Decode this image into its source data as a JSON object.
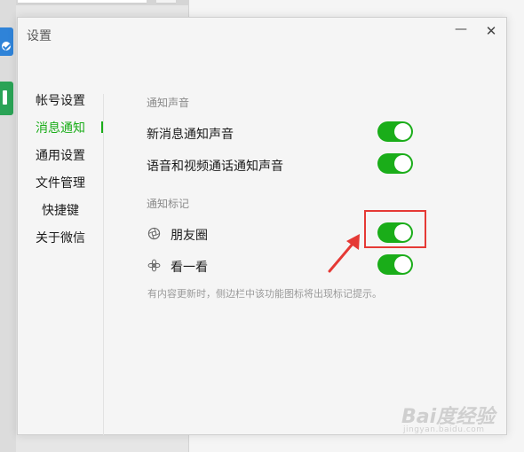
{
  "dialog": {
    "title": "设置",
    "minimize_glyph": "—",
    "close_glyph": "✕"
  },
  "nav": {
    "items": [
      {
        "label": "帐号设置",
        "active": false
      },
      {
        "label": "消息通知",
        "active": true
      },
      {
        "label": "通用设置",
        "active": false
      },
      {
        "label": "文件管理",
        "active": false
      },
      {
        "label": "快捷键",
        "active": false
      },
      {
        "label": "关于微信",
        "active": false
      }
    ]
  },
  "sections": {
    "sound_title": "通知声音",
    "badge_title": "通知标记"
  },
  "settings": {
    "new_message_sound": {
      "label": "新消息通知声音",
      "enabled": true
    },
    "call_sound": {
      "label": "语音和视频通话通知声音",
      "enabled": true
    },
    "moments": {
      "label": "朋友圈",
      "icon": "moments-icon",
      "enabled": true
    },
    "top_stories": {
      "label": "看一看",
      "icon": "top-stories-icon",
      "enabled": true
    }
  },
  "hint": "有内容更新时，侧边栏中该功能图标将出现标记提示。",
  "watermark": {
    "main": "Bai度经验",
    "sub": "jingyan.baidu.com"
  },
  "colors": {
    "accent": "#1aad19",
    "annotation": "#e53935"
  }
}
